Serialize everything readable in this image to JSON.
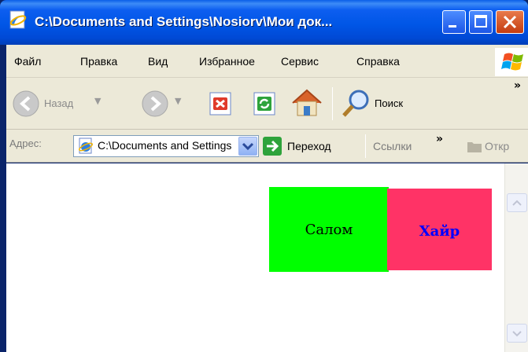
{
  "window": {
    "title": "C:\\Documents and Settings\\Nosiorv\\Мои док...",
    "app_icon": "ie-page-icon"
  },
  "menu": {
    "items": [
      "Файл",
      "Правка",
      "Вид",
      "Избранное",
      "Сервис",
      "Справка"
    ]
  },
  "toolbar": {
    "back_label": "Назад",
    "search_label": "Поиск",
    "overflow": "»"
  },
  "address": {
    "label": "Адрес:",
    "value": "C:\\Documents and Settings\\Nosiorv\\Мои документы",
    "go_label": "Переход",
    "links_label": "Ссылки",
    "links_overflow": "»",
    "extra_label": "Откр"
  },
  "page": {
    "cell_green_text": "Салом",
    "cell_pink_text": "Хайр",
    "colors": {
      "green": "#00ff00",
      "pink": "#ff3366",
      "pink_text": "#0000ff"
    }
  }
}
